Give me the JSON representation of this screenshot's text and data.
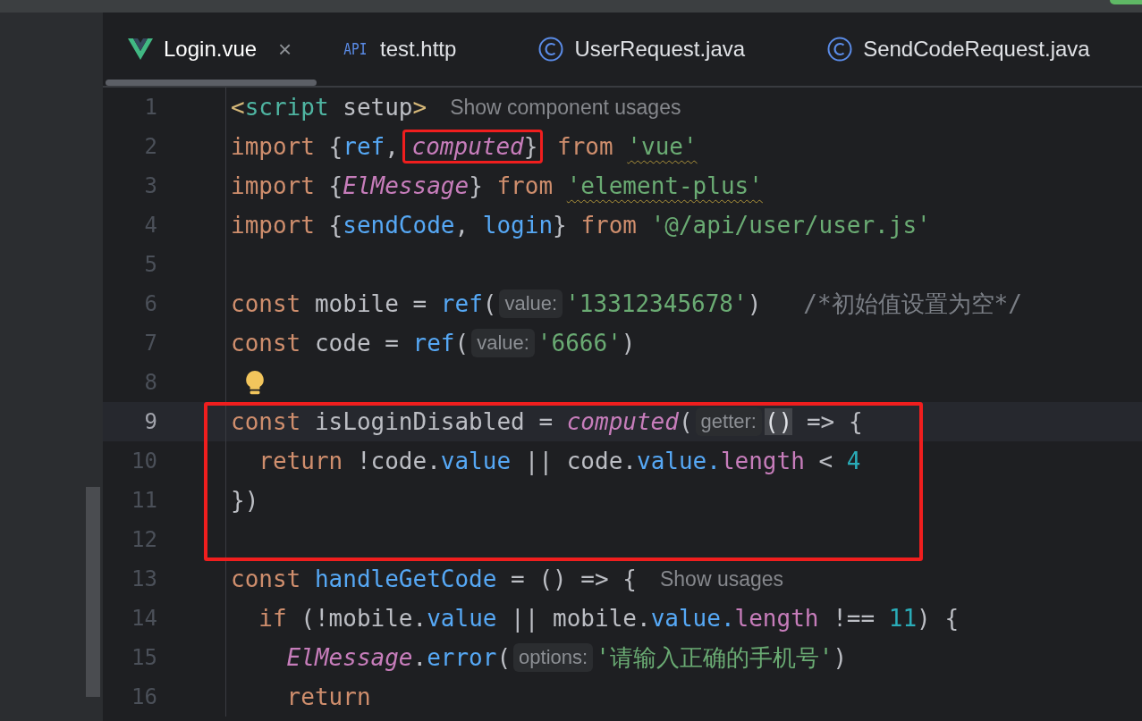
{
  "tabs": [
    {
      "kind": "vue",
      "label": "Login.vue",
      "selected": true,
      "close": "×"
    },
    {
      "kind": "http",
      "icon_text": "API",
      "label": "test.http",
      "selected": false
    },
    {
      "kind": "java",
      "label": "UserRequest.java",
      "selected": false
    },
    {
      "kind": "java",
      "label": "SendCodeRequest.java",
      "selected": false
    }
  ],
  "editor": {
    "lines": [
      {
        "number": "1",
        "tokens": [
          {
            "text": "<",
            "kind": "bracket"
          },
          {
            "text": "script",
            "kind": "tag"
          },
          {
            "text": " setup",
            "kind": "plain"
          },
          {
            "text": ">",
            "kind": "bracket"
          },
          {
            "text": "Show component usages",
            "kind": "hint"
          }
        ]
      },
      {
        "number": "2",
        "tokens": [
          {
            "text": "import",
            "kind": "kw"
          },
          {
            "text": " {",
            "kind": "plain"
          },
          {
            "text": "ref",
            "kind": "fn"
          },
          {
            "text": ", ",
            "kind": "plain"
          },
          {
            "kind": "box",
            "tokens": [
              {
                "text": "computed",
                "kind": "italic"
              },
              {
                "text": "}",
                "kind": "plain"
              }
            ]
          },
          {
            "text": " from ",
            "kind": "kw"
          },
          {
            "text": "'vue'",
            "kind": "str",
            "warning": true
          }
        ]
      },
      {
        "number": "3",
        "tokens": [
          {
            "text": "import",
            "kind": "kw"
          },
          {
            "text": " {",
            "kind": "plain"
          },
          {
            "text": "ElMessage",
            "kind": "italic"
          },
          {
            "text": "} ",
            "kind": "plain"
          },
          {
            "text": "from ",
            "kind": "kw"
          },
          {
            "text": "'element-plus'",
            "kind": "str",
            "warning": true
          }
        ]
      },
      {
        "number": "4",
        "tokens": [
          {
            "text": "import",
            "kind": "kw"
          },
          {
            "text": " {",
            "kind": "plain"
          },
          {
            "text": "sendCode",
            "kind": "fn"
          },
          {
            "text": ", ",
            "kind": "plain"
          },
          {
            "text": "login",
            "kind": "fn"
          },
          {
            "text": "} ",
            "kind": "plain"
          },
          {
            "text": "from ",
            "kind": "kw"
          },
          {
            "text": "'@/api/user/user.js'",
            "kind": "str"
          }
        ]
      },
      {
        "number": "5"
      },
      {
        "number": "6",
        "tokens": [
          {
            "text": "const",
            "kind": "kw"
          },
          {
            "text": " mobile = ",
            "kind": "plain"
          },
          {
            "text": "ref",
            "kind": "fn"
          },
          {
            "text": "(",
            "kind": "plain"
          },
          {
            "text": "value:",
            "kind": "inlay"
          },
          {
            "text": "'13312345678'",
            "kind": "str"
          },
          {
            "text": ")   ",
            "kind": "plain"
          },
          {
            "text": "/*初始值设置为空*/",
            "kind": "comment"
          }
        ]
      },
      {
        "number": "7",
        "tokens": [
          {
            "text": "const",
            "kind": "kw"
          },
          {
            "text": " code = ",
            "kind": "plain"
          },
          {
            "text": "ref",
            "kind": "fn"
          },
          {
            "text": "(",
            "kind": "plain"
          },
          {
            "text": "value:",
            "kind": "inlay"
          },
          {
            "text": "'6666'",
            "kind": "str"
          },
          {
            "text": ")",
            "kind": "plain"
          }
        ]
      },
      {
        "number": "8",
        "intention_bulb": true
      },
      {
        "kind": "box",
        "lines": [
          {
            "number": "9",
            "current": true,
            "tokens": [
              {
                "text": "const",
                "kind": "kw"
              },
              {
                "text": " isLoginDisabled = ",
                "kind": "plain"
              },
              {
                "text": "computed",
                "kind": "italic"
              },
              {
                "text": "(",
                "kind": "plain"
              },
              {
                "text": "getter:",
                "kind": "inlay"
              },
              {
                "text": "()",
                "kind": "match"
              },
              {
                "text": " => {",
                "kind": "plain"
              }
            ]
          },
          {
            "number": "10",
            "tokens": [
              {
                "text": "  return",
                "kind": "kw"
              },
              {
                "text": " !code.",
                "kind": "plain"
              },
              {
                "text": "value",
                "kind": "fn"
              },
              {
                "text": " || code.",
                "kind": "plain"
              },
              {
                "text": "value.",
                "kind": "fn"
              },
              {
                "text": "length",
                "kind": "prop"
              },
              {
                "text": " < ",
                "kind": "plain"
              },
              {
                "text": "4",
                "kind": "num"
              }
            ]
          },
          {
            "number": "11",
            "tokens": [
              {
                "text": "})",
                "kind": "plain"
              }
            ]
          },
          {
            "number": "12"
          }
        ]
      },
      {
        "number": "13",
        "tokens": [
          {
            "text": "const ",
            "kind": "kw"
          },
          {
            "text": "handleGetCode",
            "kind": "fn"
          },
          {
            "text": " = () => {",
            "kind": "plain"
          },
          {
            "text": "Show usages",
            "kind": "hint"
          }
        ]
      },
      {
        "number": "14",
        "tokens": [
          {
            "text": "  if",
            "kind": "kw"
          },
          {
            "text": " (!mobile.",
            "kind": "plain"
          },
          {
            "text": "value",
            "kind": "fn"
          },
          {
            "text": " || mobile.",
            "kind": "plain"
          },
          {
            "text": "value.",
            "kind": "fn"
          },
          {
            "text": "length",
            "kind": "prop"
          },
          {
            "text": " !== ",
            "kind": "plain"
          },
          {
            "text": "11",
            "kind": "num"
          },
          {
            "text": ") {",
            "kind": "plain"
          }
        ]
      },
      {
        "number": "15",
        "tokens": [
          {
            "text": "    ElMessage",
            "kind": "italic"
          },
          {
            "text": ".",
            "kind": "plain"
          },
          {
            "text": "error",
            "kind": "fn"
          },
          {
            "text": "(",
            "kind": "plain"
          },
          {
            "text": "options:",
            "kind": "inlay"
          },
          {
            "text": "'请输入正确的手机号'",
            "kind": "str"
          },
          {
            "text": ")",
            "kind": "plain"
          }
        ]
      },
      {
        "number": "16",
        "tokens": [
          {
            "text": "    return",
            "kind": "kw"
          }
        ]
      }
    ]
  }
}
